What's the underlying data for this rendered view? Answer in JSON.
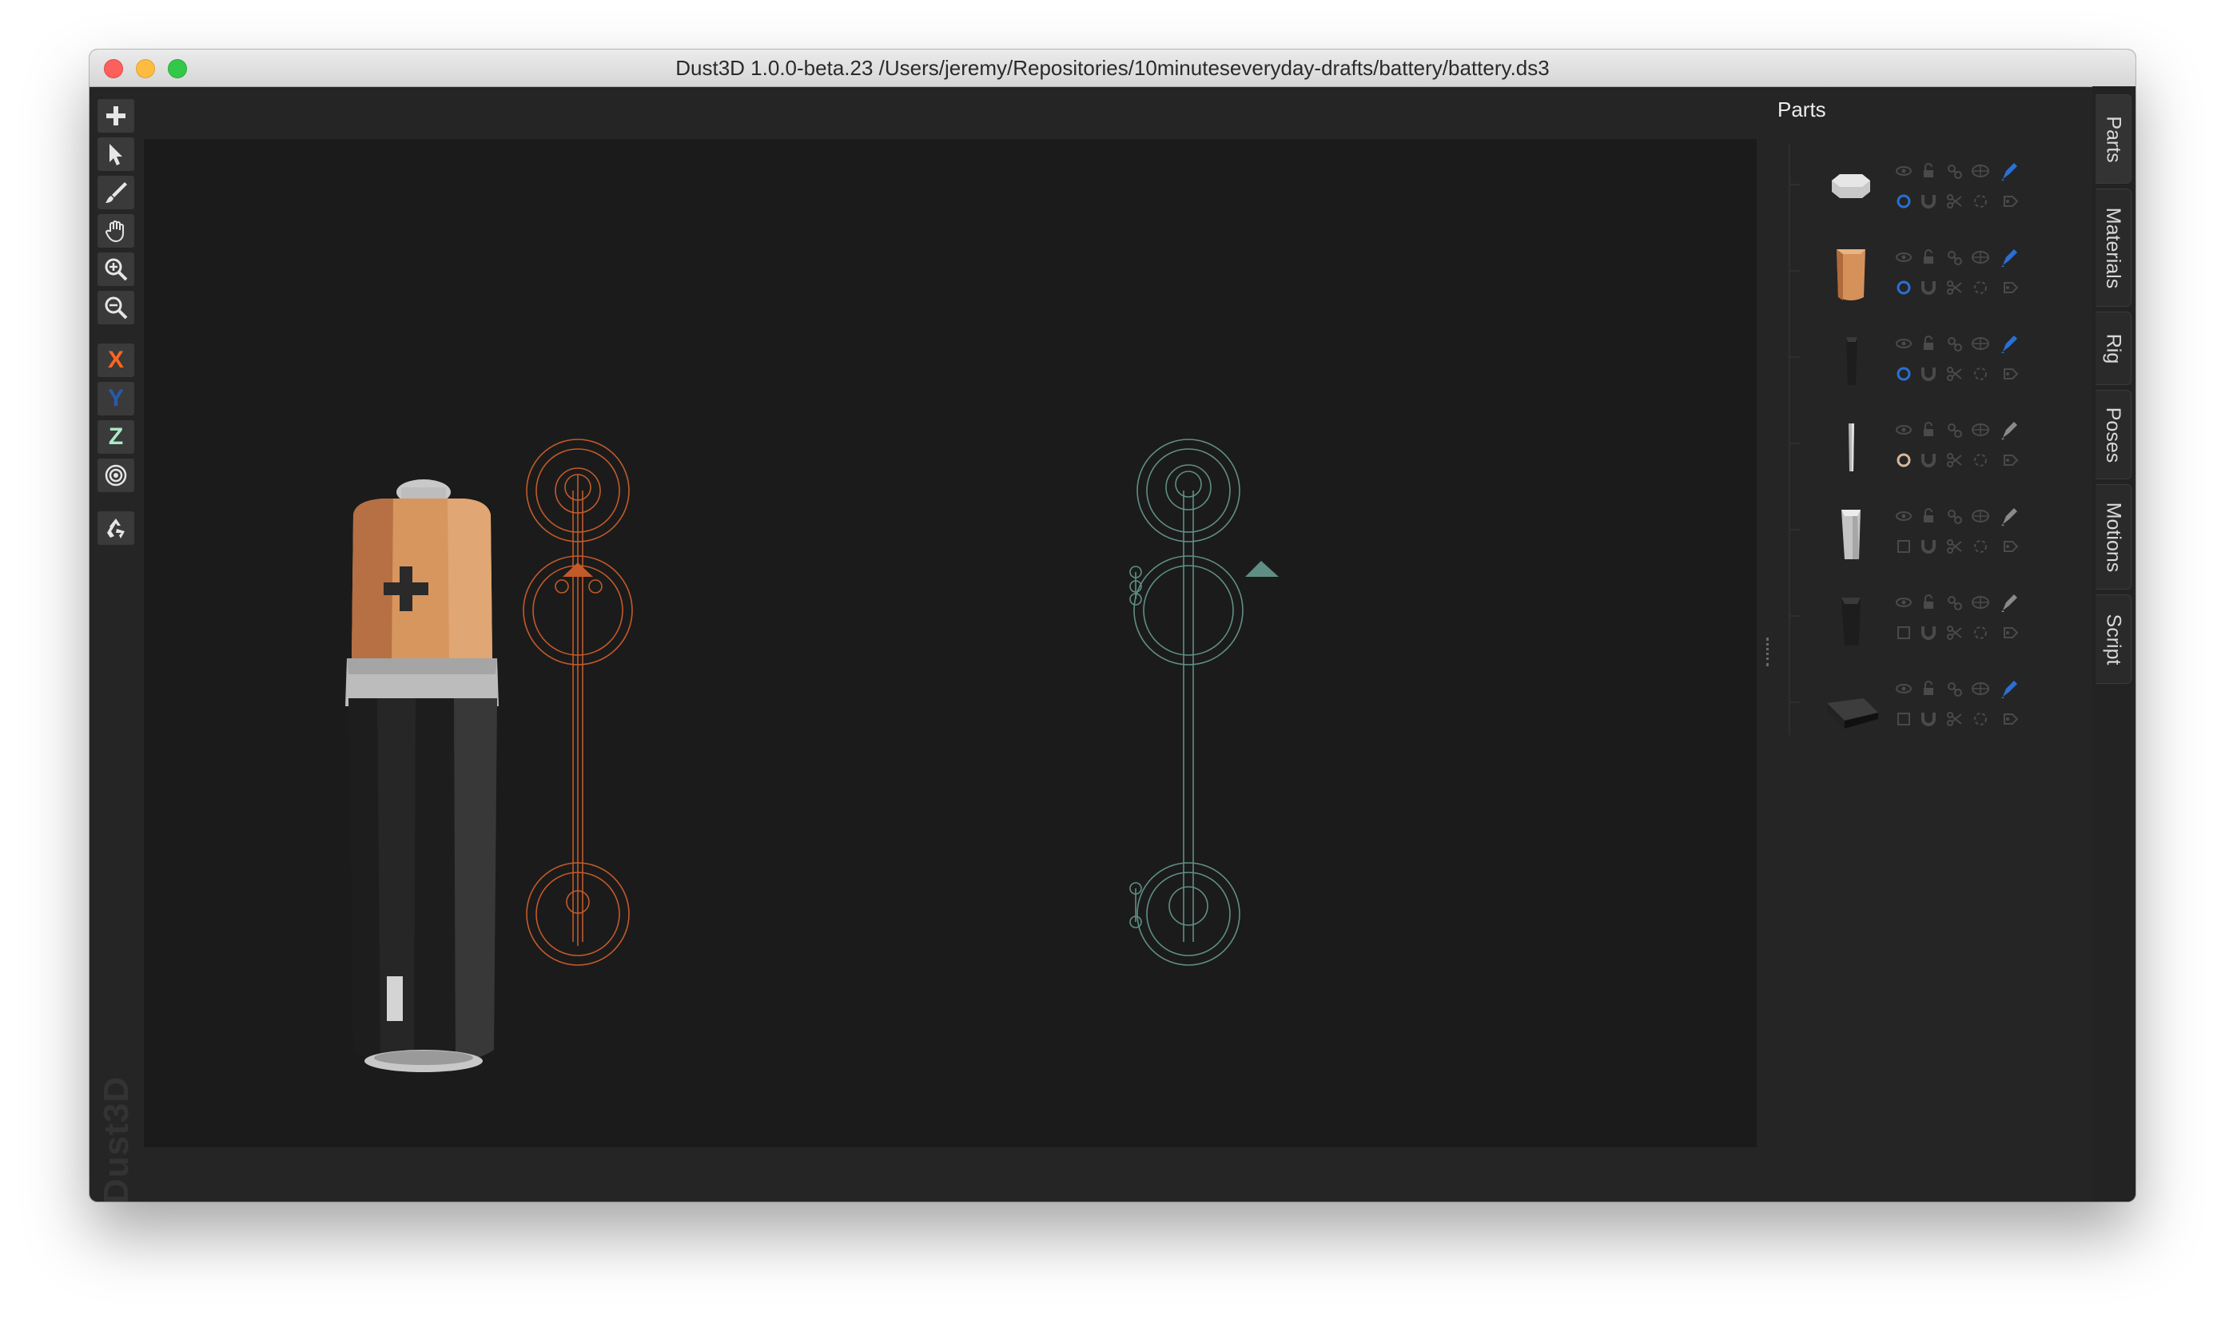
{
  "window": {
    "title": "Dust3D 1.0.0-beta.23 /Users/jeremy/Repositories/10minuteseveryday-drafts/battery/battery.ds3"
  },
  "toolbar": {
    "tools": [
      {
        "name": "add-icon"
      },
      {
        "name": "select-icon"
      },
      {
        "name": "paint-brush-icon"
      },
      {
        "name": "hand-icon"
      },
      {
        "name": "zoom-in-icon"
      },
      {
        "name": "zoom-out-icon"
      }
    ],
    "axes": {
      "x_label": "X",
      "y_label": "Y",
      "z_label": "Z"
    },
    "axis_colors": {
      "x": "#fc6621",
      "y": "#2a5aac",
      "z": "#aaebc4"
    },
    "radial_icon": "radial-target-icon",
    "regenerate_icon": "recycle-icon"
  },
  "logo": {
    "text": "Dust3D"
  },
  "parts_panel": {
    "title": "Parts",
    "parts": [
      {
        "shape": "cap",
        "color": "#c8c8c8",
        "active_edit": true,
        "dot_color": "#2a6fd6"
      },
      {
        "shape": "copper",
        "color": "#d4925a",
        "active_edit": true,
        "dot_color": "#2a6fd6"
      },
      {
        "shape": "black-cylinder",
        "color": "#1d1d1d",
        "active_edit": true,
        "dot_color": "#2a6fd6"
      },
      {
        "shape": "thin-stick",
        "color": "#b5b5b5",
        "active_edit": false,
        "dot_color": "#d6b89c"
      },
      {
        "shape": "grey-cylinder",
        "color": "#c4c4c4",
        "active_edit": false,
        "dot_color": "none"
      },
      {
        "shape": "black-block",
        "color": "#1d1d1d",
        "active_edit": false,
        "dot_color": "none"
      },
      {
        "shape": "black-slab",
        "color": "#222222",
        "active_edit": true,
        "dot_color": "none"
      }
    ]
  },
  "side_tabs": [
    "Parts",
    "Materials",
    "Rig",
    "Poses",
    "Motions",
    "Script"
  ],
  "colors": {
    "front_profile": "#c25a2a",
    "side_profile": "#5f8f84",
    "accent_blue": "#2a6fd6"
  }
}
